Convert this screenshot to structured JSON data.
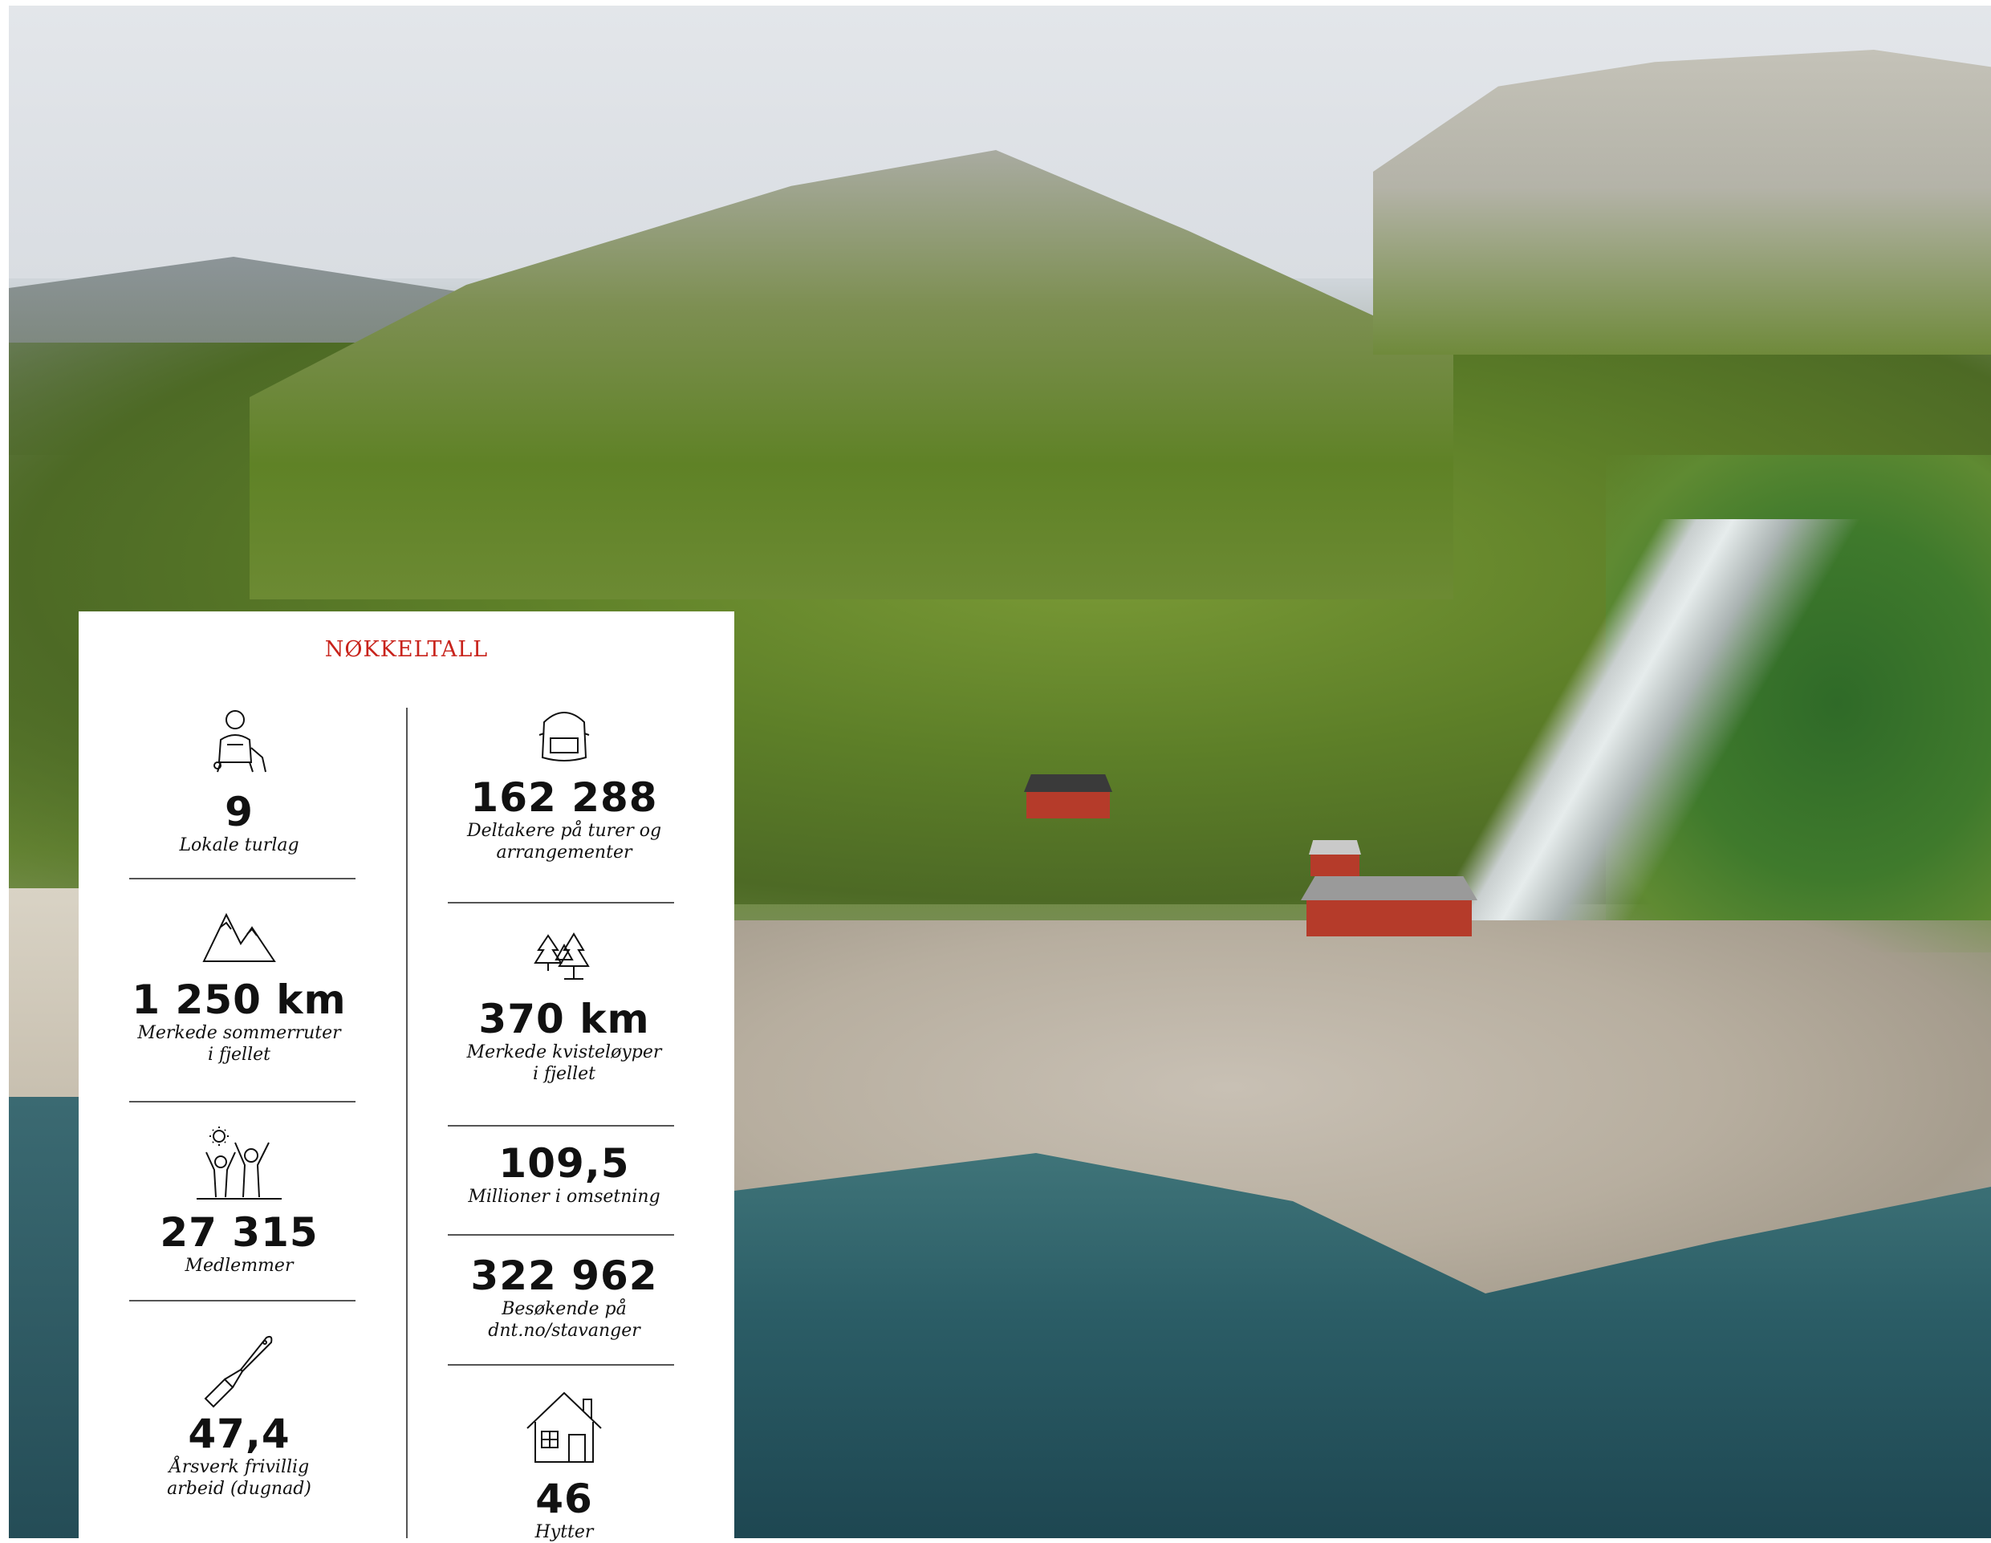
{
  "panel": {
    "title": "NØKKELTALL",
    "left_column": [
      {
        "icon": "hiker-icon",
        "value": "9",
        "label": "Lokale turlag"
      },
      {
        "icon": "mountains-icon",
        "value": "1 250 km",
        "label": "Merkede sommerruter\ni fjellet"
      },
      {
        "icon": "people-sun-icon",
        "value": "27 315",
        "label": "Medlemmer"
      },
      {
        "icon": "paintbrush-icon",
        "value": "47,4",
        "label": "Årsverk frivillig\narbeid (dugnad)"
      }
    ],
    "right_column": [
      {
        "icon": "backpack-icon",
        "value": "162 288",
        "label": "Deltakere på turer og\narrangementer"
      },
      {
        "icon": "trees-icon",
        "value": "370 km",
        "label": "Merkede kvisteløyper\ni fjellet"
      },
      {
        "icon": "",
        "value": "109,5",
        "label": "Millioner i omsetning"
      },
      {
        "icon": "",
        "value": "322 962",
        "label": "Besøkende på\ndnt.no/stavanger"
      },
      {
        "icon": "house-icon",
        "value": "46",
        "label": "Hytter"
      }
    ]
  },
  "colors": {
    "title_red": "#c8231b",
    "text": "#111111",
    "rule": "#555555"
  }
}
